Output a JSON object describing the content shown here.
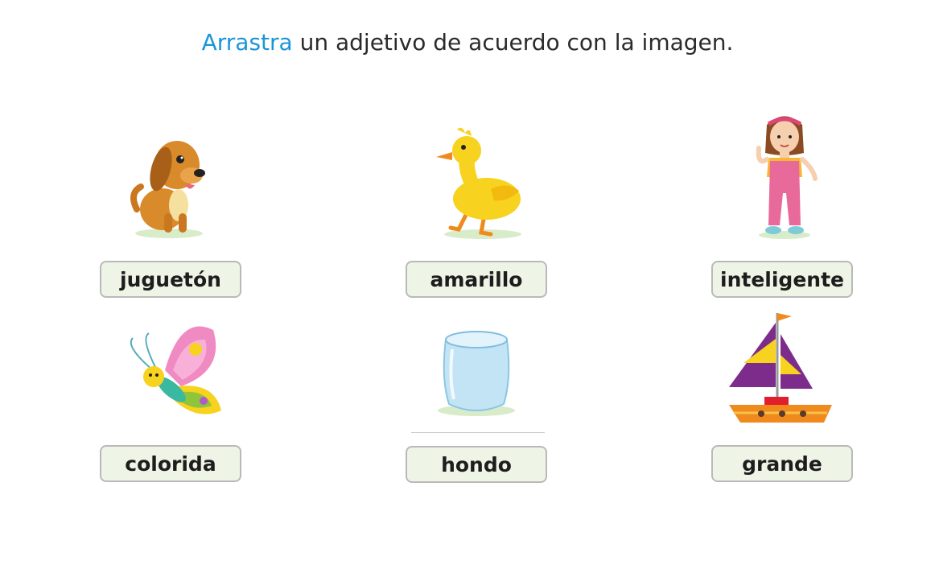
{
  "instruction": {
    "accent": "Arrastra",
    "rest": " un adjetivo de acuerdo con la imagen."
  },
  "cards": [
    {
      "image": "dog-image",
      "word": "juguetón"
    },
    {
      "image": "duck-image",
      "word": "amarillo"
    },
    {
      "image": "girl-image",
      "word": "inteligente"
    },
    {
      "image": "butterfly-image",
      "word": "colorida"
    },
    {
      "image": "glass-image",
      "word": "hondo"
    },
    {
      "image": "sailboat-image",
      "word": "grande"
    }
  ],
  "colors": {
    "accent": "#1a96d8",
    "chip_background": "#eef5e6",
    "chip_border": "#b9b9b9"
  }
}
